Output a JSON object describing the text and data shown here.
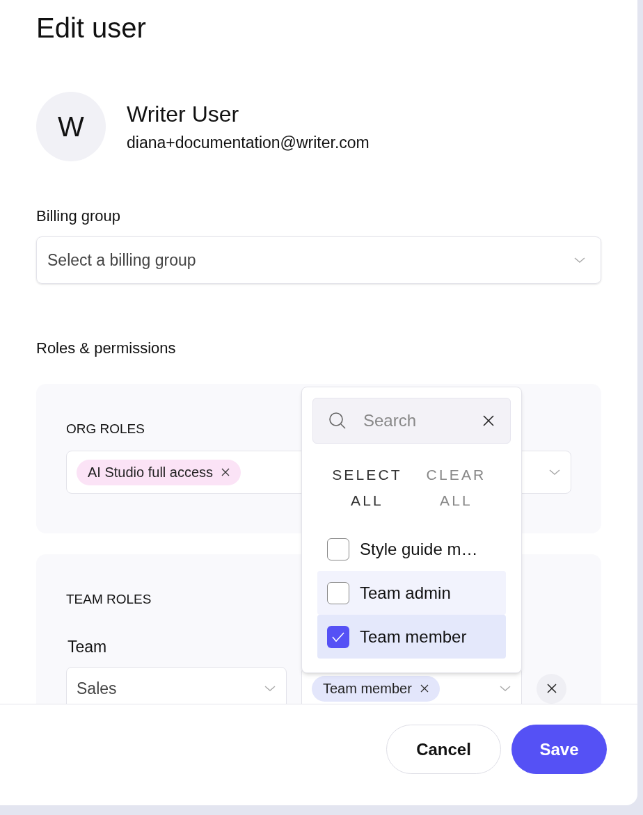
{
  "title": "Edit user",
  "user": {
    "initial": "W",
    "name": "Writer User",
    "email": "diana+documentation@writer.com"
  },
  "billing_group": {
    "label": "Billing group",
    "placeholder": "Select a billing group"
  },
  "roles_heading": "Roles & permissions",
  "org_roles": {
    "heading": "ORG ROLES",
    "chips": [
      {
        "label": "AI Studio full access"
      }
    ]
  },
  "team_roles": {
    "heading": "TEAM ROLES",
    "column_1": "Team",
    "rows": [
      {
        "team": "Sales",
        "roles": [
          {
            "label": "Team member"
          }
        ]
      }
    ]
  },
  "dropdown": {
    "search_placeholder": "Search",
    "select_all": "SELECT ALL",
    "clear_all": "CLEAR ALL",
    "options": [
      {
        "label": "Style guide m…",
        "checked": false,
        "hovered": false
      },
      {
        "label": "Team admin",
        "checked": false,
        "hovered": true
      },
      {
        "label": "Team member",
        "checked": true,
        "hovered": false
      }
    ]
  },
  "footer": {
    "cancel": "Cancel",
    "save": "Save"
  }
}
